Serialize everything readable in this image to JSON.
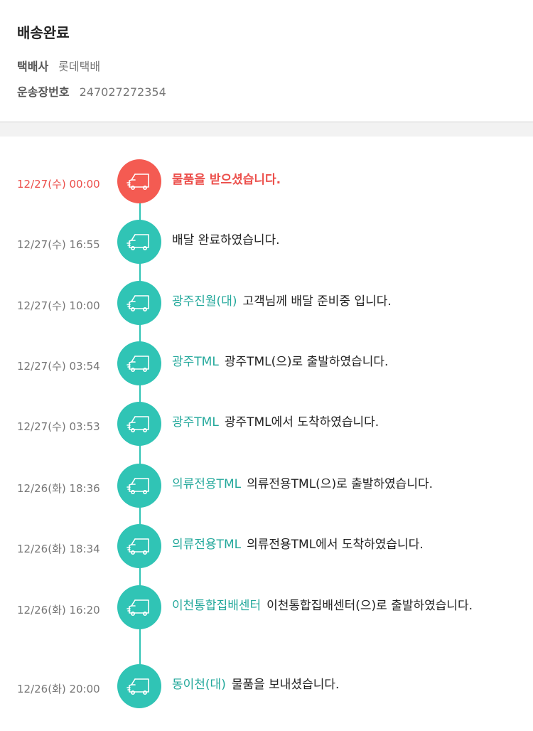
{
  "header": {
    "title": "배송완료",
    "courier_label": "택배사",
    "courier_value": "롯데택배",
    "tracking_label": "운송장번호",
    "tracking_value": "247027272354"
  },
  "icon": "truck-icon",
  "colors": {
    "teal": "#30c4b5",
    "teal_text": "#23a89b",
    "red": "#f45b52"
  },
  "timeline": [
    {
      "time": "12/27(수) 00:00",
      "location": "",
      "message": "물품을 받으셨습니다."
    },
    {
      "time": "12/27(수) 16:55",
      "location": "",
      "message": "배달 완료하였습니다."
    },
    {
      "time": "12/27(수) 10:00",
      "location": "광주진월(대)",
      "message": "고객님께 배달 준비중 입니다."
    },
    {
      "time": "12/27(수) 03:54",
      "location": "광주TML",
      "message": "광주TML(으)로 출발하였습니다."
    },
    {
      "time": "12/27(수) 03:53",
      "location": "광주TML",
      "message": "광주TML에서 도착하였습니다."
    },
    {
      "time": "12/26(화) 18:36",
      "location": "의류전용TML",
      "message": "의류전용TML(으)로 출발하였습니다."
    },
    {
      "time": "12/26(화) 18:34",
      "location": "의류전용TML",
      "message": "의류전용TML에서 도착하였습니다."
    },
    {
      "time": "12/26(화) 16:20",
      "location": "이천통합집배센터",
      "message": "이천통합집배센터(으)로 출발하였습니다."
    },
    {
      "time": "12/26(화) 20:00",
      "location": "동이천(대)",
      "message": "물품을 보내셨습니다."
    }
  ]
}
